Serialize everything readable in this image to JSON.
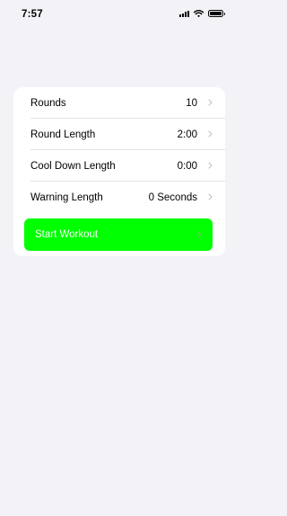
{
  "status_bar": {
    "time": "7:57"
  },
  "settings": {
    "rows": [
      {
        "label": "Rounds",
        "value": "10"
      },
      {
        "label": "Round Length",
        "value": "2:00"
      },
      {
        "label": "Cool Down Length",
        "value": "0:00"
      },
      {
        "label": "Warning Length",
        "value": "0 Seconds"
      }
    ],
    "start_button": {
      "label": "Start Workout",
      "color": "#00ff00"
    }
  },
  "colors": {
    "background": "#f2f2f7",
    "card": "#ffffff",
    "chevron": "#c4c4c7"
  },
  "icons": [
    "signal-icon",
    "wifi-icon",
    "battery-icon",
    "chevron-right-icon"
  ]
}
